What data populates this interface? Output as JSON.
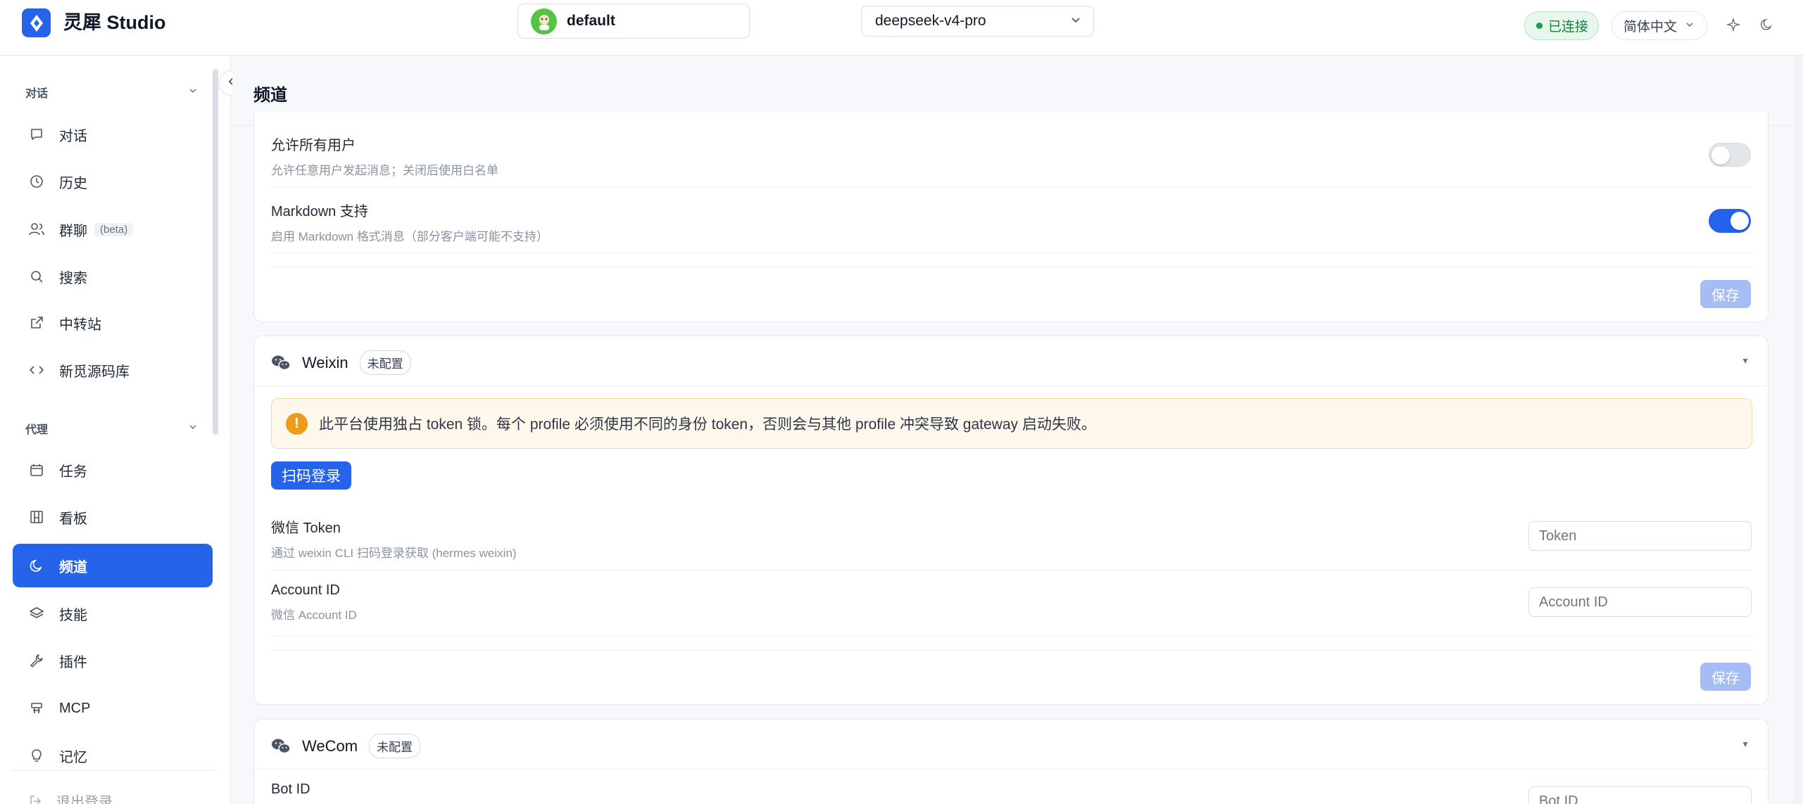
{
  "app": {
    "brand": "灵犀 Studio"
  },
  "header": {
    "profile_name": "default",
    "model": "deepseek-v4-pro",
    "status": "已连接",
    "language": "简体中文"
  },
  "sidebar": {
    "section_chat": "对话",
    "section_agent": "代理",
    "items": [
      {
        "label": "对话",
        "icon": "chat-icon"
      },
      {
        "label": "历史",
        "icon": "clock-icon"
      },
      {
        "label": "群聊",
        "icon": "users-icon",
        "badge": "(beta)"
      },
      {
        "label": "搜索",
        "icon": "search-icon"
      },
      {
        "label": "中转站",
        "icon": "external-link-icon"
      },
      {
        "label": "新觅源码库",
        "icon": "code-icon"
      },
      {
        "label": "任务",
        "icon": "calendar-icon"
      },
      {
        "label": "看板",
        "icon": "board-icon"
      },
      {
        "label": "频道",
        "icon": "moon-icon",
        "active": true
      },
      {
        "label": "技能",
        "icon": "layers-icon"
      },
      {
        "label": "插件",
        "icon": "wrench-icon"
      },
      {
        "label": "MCP",
        "icon": "mcp-icon"
      },
      {
        "label": "记忆",
        "icon": "lightbulb-icon"
      }
    ],
    "logout": "退出登录"
  },
  "main": {
    "title": "频道",
    "card_top": {
      "rows": [
        {
          "title": "允许所有用户",
          "desc": "允许任意用户发起消息；关闭后使用白名单",
          "enabled": false
        },
        {
          "title": "Markdown 支持",
          "desc": "启用 Markdown 格式消息（部分客户端可能不支持）",
          "enabled": true
        }
      ],
      "save": "保存"
    },
    "weixin": {
      "name": "Weixin",
      "badge": "未配置",
      "warning": "此平台使用独占 token 锁。每个 profile 必须使用不同的身份 token，否则会与其他 profile 冲突导致 gateway 启动失败。",
      "scan_button": "扫码登录",
      "fields": [
        {
          "title": "微信 Token",
          "desc": "通过 weixin CLI 扫码登录获取 (hermes weixin)",
          "placeholder": "Token"
        },
        {
          "title": "Account ID",
          "desc": "微信 Account ID",
          "placeholder": "Account ID"
        }
      ],
      "save": "保存"
    },
    "wecom": {
      "name": "WeCom",
      "badge": "未配置",
      "field_title": "Bot ID",
      "placeholder": "Bot ID"
    }
  },
  "colors": {
    "accent": "#2563eb",
    "status_green": "#16a34a",
    "warning": "#ee9b1a"
  }
}
